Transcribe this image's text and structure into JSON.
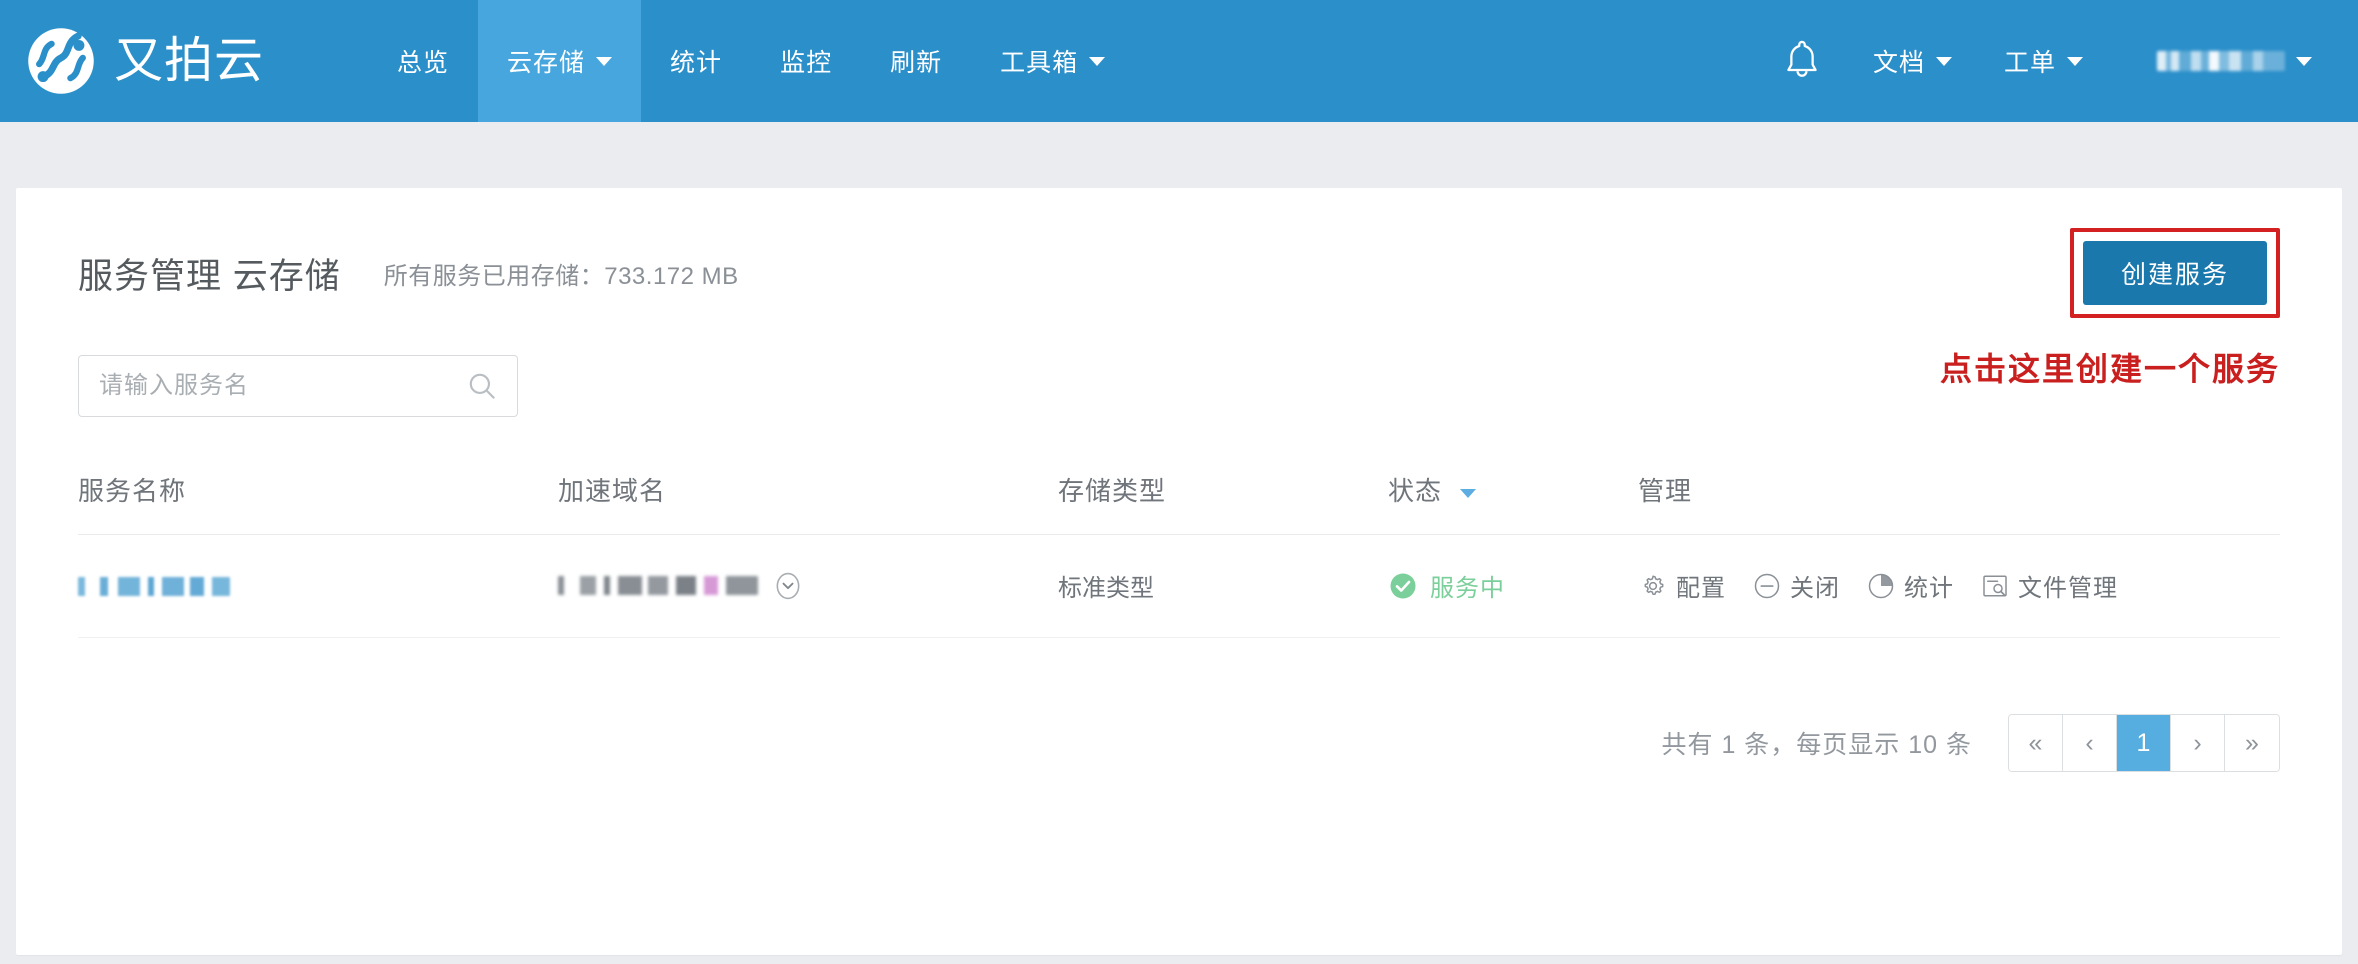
{
  "navbar": {
    "brand": {
      "name": "又拍云",
      "logo_icon": "upyun-logo-icon"
    },
    "items": [
      {
        "label": "总览",
        "has_caret": false,
        "active": false
      },
      {
        "label": "云存储",
        "has_caret": true,
        "active": true
      },
      {
        "label": "统计",
        "has_caret": false,
        "active": false
      },
      {
        "label": "监控",
        "has_caret": false,
        "active": false
      },
      {
        "label": "刷新",
        "has_caret": false,
        "active": false
      },
      {
        "label": "工具箱",
        "has_caret": true,
        "active": false
      }
    ],
    "right": {
      "bell_icon": "bell-icon",
      "docs": {
        "label": "文档",
        "has_caret": true
      },
      "tickets": {
        "label": "工单",
        "has_caret": true
      },
      "user": {
        "label": "",
        "redacted": true,
        "has_caret": true
      }
    },
    "colors": {
      "background": "#2b8fca",
      "active_tab": "#46a6dd"
    }
  },
  "page": {
    "title": "服务管理 云存储",
    "storage_total": "所有服务已用存储：733.172 MB",
    "create_button": "创建服务",
    "callout": "点击这里创建一个服务",
    "colors": {
      "callout_red": "#c9201f",
      "button_blue": "#1a78ad",
      "page_background": "#eaecf0"
    }
  },
  "search": {
    "placeholder": "请输入服务名",
    "value": "",
    "icon": "search-icon"
  },
  "table": {
    "columns": [
      {
        "label": "服务名称",
        "sortable": false
      },
      {
        "label": "加速域名",
        "sortable": false
      },
      {
        "label": "存储类型",
        "sortable": false
      },
      {
        "label": "状态",
        "sortable": true
      },
      {
        "label": "管理",
        "sortable": false
      }
    ],
    "rows": [
      {
        "service_name": "",
        "service_name_redacted": true,
        "domain": "",
        "domain_redacted": true,
        "domain_expand_icon": "chevron-down-circle-icon",
        "storage_type": "标准类型",
        "status": {
          "label": "服务中",
          "icon": "check-circle-icon",
          "color": "#7bcf9a"
        },
        "actions": [
          {
            "label": "配置",
            "icon": "gear-icon"
          },
          {
            "label": "关闭",
            "icon": "minus-circle-icon"
          },
          {
            "label": "统计",
            "icon": "pie-chart-icon"
          },
          {
            "label": "文件管理",
            "icon": "file-search-icon"
          }
        ]
      }
    ]
  },
  "pagination": {
    "summary": "共有 1 条，每页显示 10 条",
    "buttons": [
      {
        "label": "«",
        "name": "first",
        "current": false
      },
      {
        "label": "‹",
        "name": "prev",
        "current": false
      },
      {
        "label": "1",
        "name": "page-1",
        "current": true
      },
      {
        "label": "›",
        "name": "next",
        "current": false
      },
      {
        "label": "»",
        "name": "last",
        "current": false
      }
    ]
  }
}
